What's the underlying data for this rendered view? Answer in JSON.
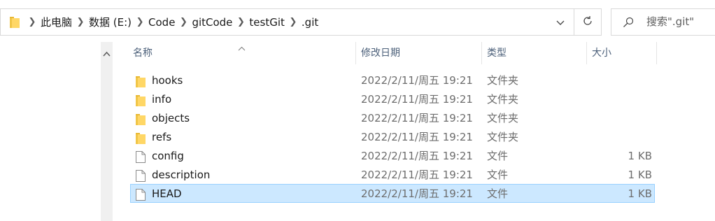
{
  "address_bar": {
    "breadcrumbs": [
      "此电脑",
      "数据 (E:)",
      "Code",
      "gitCode",
      "testGit",
      ".git"
    ]
  },
  "search": {
    "placeholder": "搜索\".git\""
  },
  "columns": {
    "name": "名称",
    "modified": "修改日期",
    "type": "类型",
    "size": "大小"
  },
  "files": [
    {
      "name": "hooks",
      "modified": "2022/2/11/周五 19:21",
      "type": "文件夹",
      "size": "",
      "icon": "folder-icon"
    },
    {
      "name": "info",
      "modified": "2022/2/11/周五 19:21",
      "type": "文件夹",
      "size": "",
      "icon": "folder-icon"
    },
    {
      "name": "objects",
      "modified": "2022/2/11/周五 19:21",
      "type": "文件夹",
      "size": "",
      "icon": "folder-icon"
    },
    {
      "name": "refs",
      "modified": "2022/2/11/周五 19:21",
      "type": "文件夹",
      "size": "",
      "icon": "folder-icon"
    },
    {
      "name": "config",
      "modified": "2022/2/11/周五 19:21",
      "type": "文件",
      "size": "1 KB",
      "icon": "file-icon"
    },
    {
      "name": "description",
      "modified": "2022/2/11/周五 19:21",
      "type": "文件",
      "size": "1 KB",
      "icon": "file-icon"
    },
    {
      "name": "HEAD",
      "modified": "2022/2/11/周五 19:21",
      "type": "文件",
      "size": "1 KB",
      "icon": "file-icon",
      "selected": true
    }
  ],
  "colors": {
    "folder": "#ffd766",
    "folder_dark": "#e8b833",
    "selection_bg": "#cce8ff",
    "selection_border": "#99d1ff",
    "header_text": "#4c607a"
  }
}
